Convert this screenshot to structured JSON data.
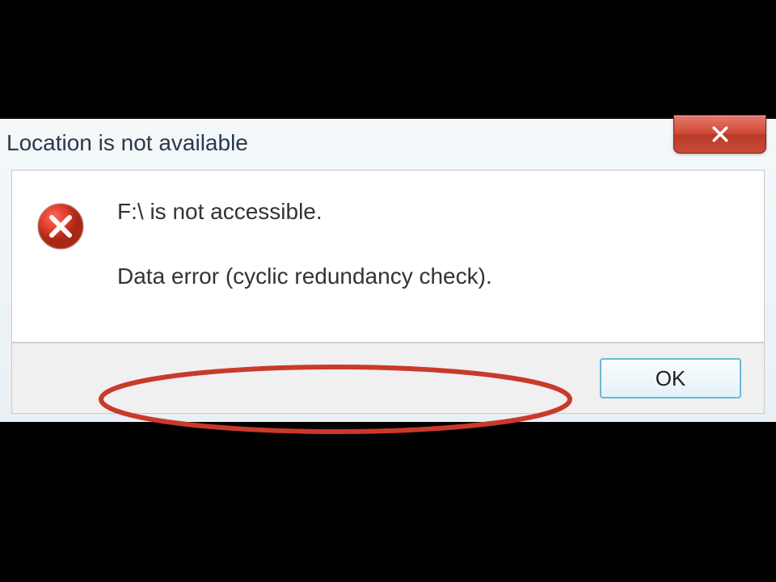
{
  "dialog": {
    "title": "Location is not available",
    "message_primary": "F:\\ is not accessible.",
    "message_secondary": "Data error (cyclic redundancy check).",
    "ok_label": "OK",
    "icon": "error-x-icon",
    "close_icon": "close-icon",
    "annotation_color": "#c93a2b"
  }
}
